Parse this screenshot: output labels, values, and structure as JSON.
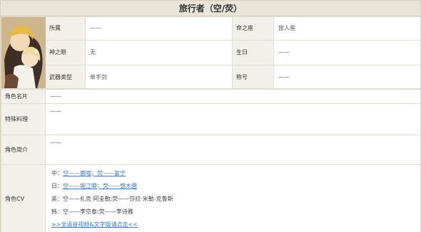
{
  "header": {
    "title": "旅行者（空/荧）"
  },
  "info": {
    "row1": {
      "label_a": "所属",
      "value_a": "——",
      "label_b": "命之座",
      "value_b": "旅人座"
    },
    "row2": {
      "label_a": "神之眼",
      "value_a": "无",
      "label_b": "生日",
      "value_b": "——"
    },
    "row3": {
      "label_a": "武器类型",
      "value_a": "单手剑",
      "label_b": "称号",
      "value_b": "——"
    }
  },
  "details": {
    "card_label": "角色名片",
    "card_value": "——",
    "dish_label": "特殊料理",
    "dish_value": "——",
    "intro_label": "角色简介",
    "intro_value": "——",
    "cv_label": "角色CV"
  },
  "cv": {
    "cn_prefix": "中：",
    "cn_link": "空——鹿喵；荧——宴宁",
    "jp_prefix": "日：",
    "jp_link": "空——堀江瞬；荧——悠木碧",
    "en_text": "英：空——扎克·阿圭勒;荧——莎拉·米勒-克鲁斯",
    "kr_text": "韩：空——李京泰;荧——李诗雅",
    "full_link": ">>全语音视频&文字版请点击<<"
  }
}
